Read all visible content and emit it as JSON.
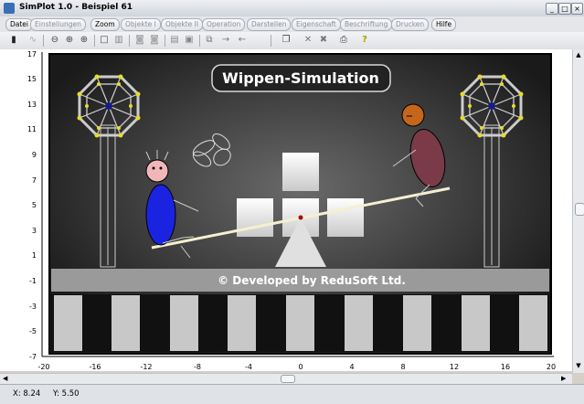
{
  "window": {
    "title": "SimPlot 1.0 - Beispiel 61"
  },
  "menu": [
    {
      "label": "Datei",
      "enabled": true
    },
    {
      "label": "Einstellungen",
      "enabled": false
    },
    {
      "label": "Zoom",
      "enabled": true
    },
    {
      "label": "Objekte I",
      "enabled": false
    },
    {
      "label": "Objekte II",
      "enabled": false
    },
    {
      "label": "Operation",
      "enabled": false
    },
    {
      "label": "Darstellen",
      "enabled": false
    },
    {
      "label": "Eigenschaft",
      "enabled": false
    },
    {
      "label": "Beschriftung",
      "enabled": false
    },
    {
      "label": "Drucken",
      "enabled": false
    },
    {
      "label": "Hilfe",
      "enabled": true
    }
  ],
  "toolbar": {
    "icons": [
      "exit-icon",
      "graph-icon",
      "zoom-out-icon",
      "zoom-in-icon",
      "zoom-fit-icon",
      "select-rect-icon",
      "table-icon",
      "object-a-icon",
      "object-b-icon",
      "grid-icon",
      "image-icon",
      "copy-object-icon",
      "arrow-right-icon",
      "arrow-left-icon",
      "document-icon",
      "delete-icon",
      "delete-all-icon",
      "print-icon",
      "help-icon"
    ]
  },
  "plot": {
    "scene_title": "Wippen-Simulation",
    "banner_text": "© Developed by ReduSoft Ltd.",
    "x_ticks": [
      "-20",
      "-16",
      "-12",
      "-8",
      "-4",
      "0",
      "4",
      "8",
      "12",
      "16",
      "20"
    ],
    "y_ticks": [
      "17",
      "15",
      "13",
      "11",
      "9",
      "7",
      "5",
      "3",
      "1",
      "-1",
      "-3",
      "-5",
      "-7"
    ],
    "colors": {
      "scene_bg": "#3c3c3c",
      "left_figure": "#1a24e0",
      "right_figure": "#7a3a48",
      "head_left": "#f3b6b8",
      "head_right": "#c4661c"
    }
  },
  "status": {
    "x": "X: 8.24",
    "y": "Y: 5.50"
  }
}
